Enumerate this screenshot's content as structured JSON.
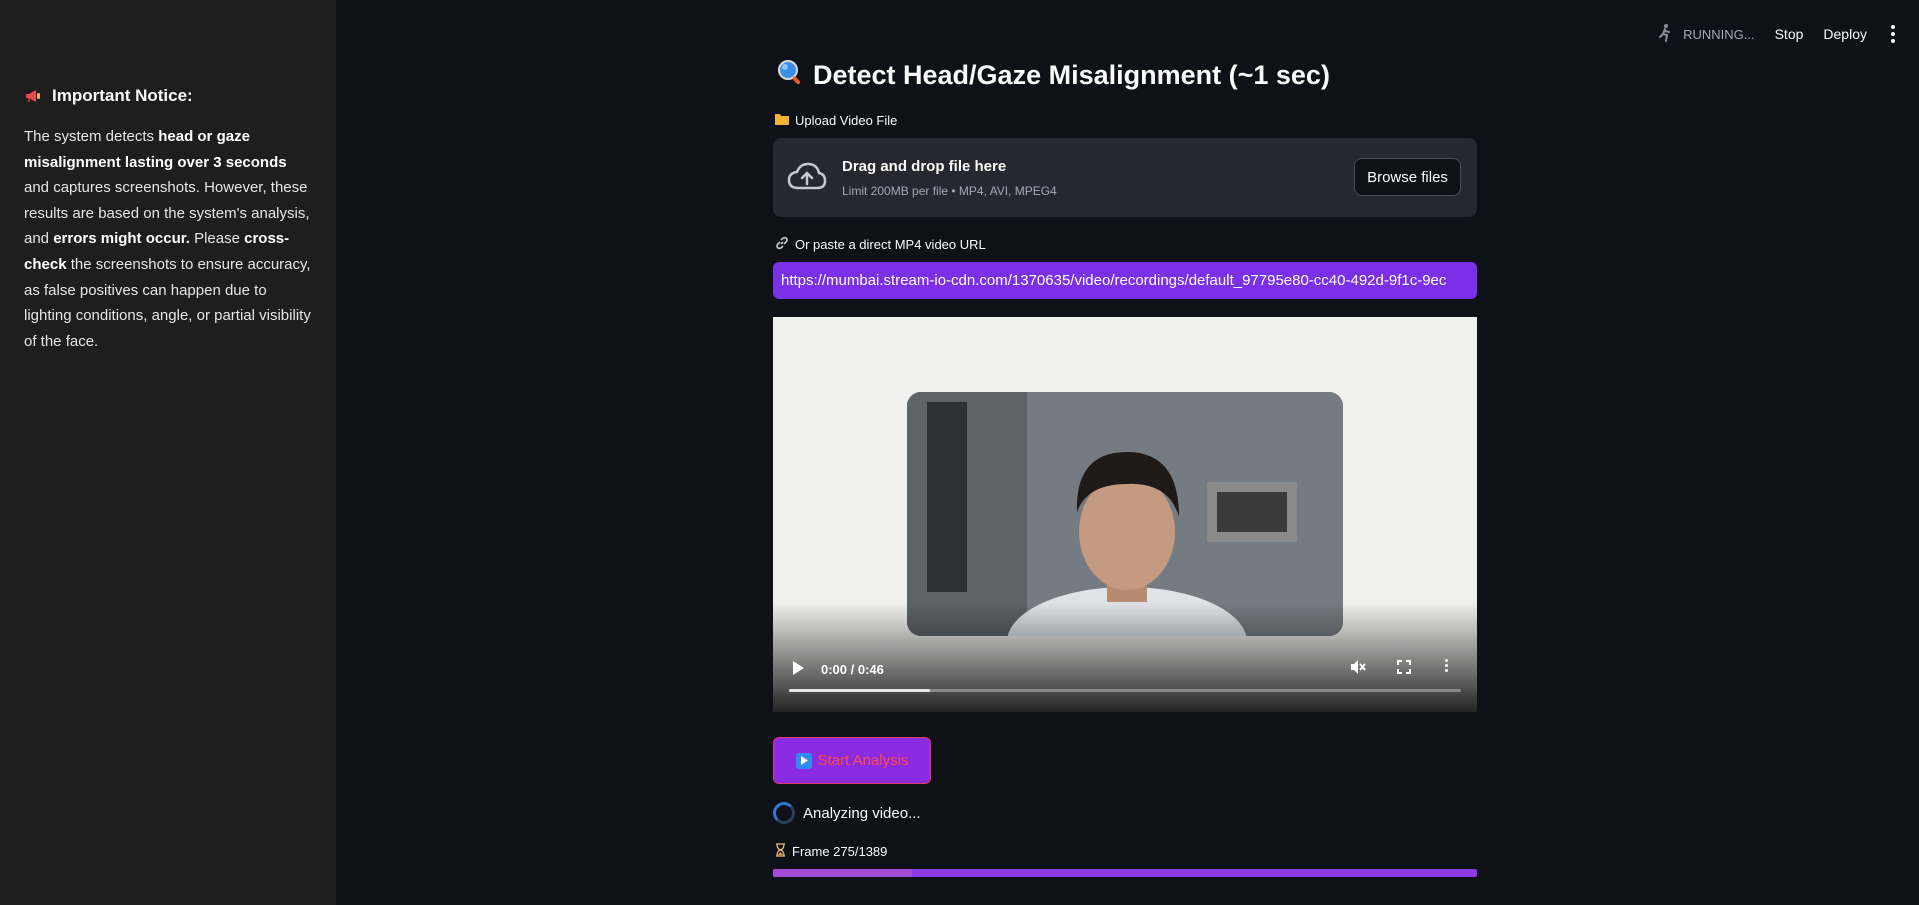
{
  "sidebar": {
    "notice_title": "Important Notice:",
    "notice_parts": {
      "p1": "The system detects ",
      "b1": "head or gaze misalignment lasting over 3 seconds",
      "p2": " and captures screenshots. However, these results are based on the system's analysis, and ",
      "b2": "errors might occur.",
      "p3": " Please ",
      "b3": "cross-check",
      "p4": " the screenshots to ensure accuracy, as false positives can happen due to lighting conditions, angle, or partial visibility of the face."
    }
  },
  "header": {
    "status": "RUNNING...",
    "stop_label": "Stop",
    "deploy_label": "Deploy"
  },
  "main": {
    "title": "Detect Head/Gaze Misalignment (~1 sec)",
    "upload_label": "Upload Video File",
    "uploader": {
      "title": "Drag and drop file here",
      "subtitle": "Limit 200MB per file • MP4, AVI, MPEG4",
      "browse_label": "Browse files"
    },
    "url_label": "Or paste a direct MP4 video URL",
    "url_value": "https://mumbai.stream-io-cdn.com/1370635/video/recordings/default_97795e80-cc40-492d-9f1c-9ec",
    "video": {
      "time": "0:00 / 0:46",
      "progress": 0.21
    },
    "start_label": "Start Analysis",
    "analyzing_text": "Analyzing video...",
    "frame_text": "Frame 275/1389",
    "frame_progress": 0.198
  },
  "colors": {
    "accent": "#7b2fe6",
    "sidebar_bg": "#1e1e1e",
    "app_bg": "#0e1117"
  }
}
